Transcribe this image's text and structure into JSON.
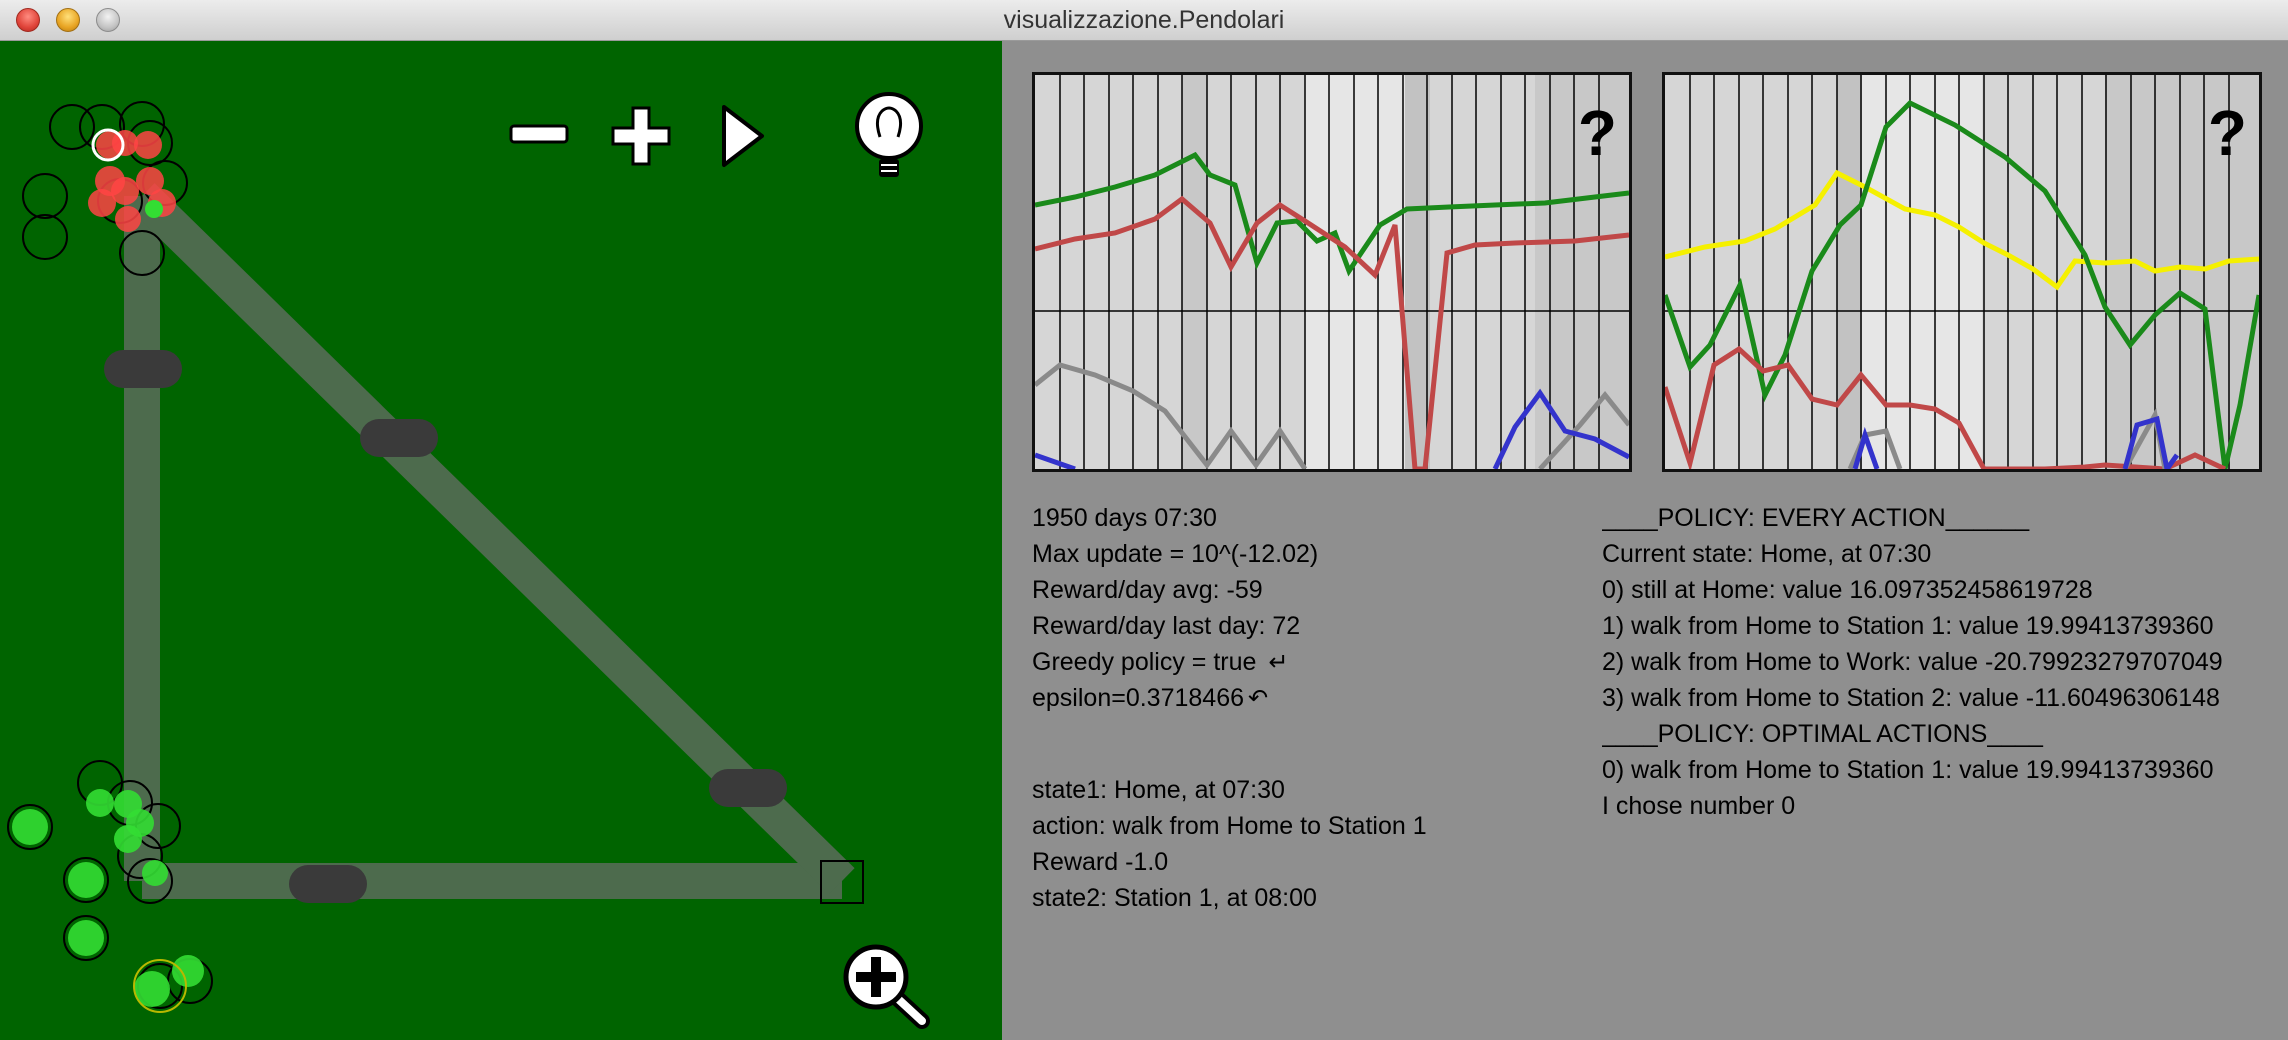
{
  "window": {
    "title": "visualizzazione.Pendolari"
  },
  "controls": {
    "zoom_out": "minus-icon",
    "zoom_in": "plus-icon",
    "play": "play-icon",
    "hint": "lightbulb-icon",
    "magnify": "magnifier-zoom-icon"
  },
  "colors": {
    "sim_background": "#006400",
    "road": "#4a6b4a",
    "station": "#3a3a3a",
    "commuter_red": "#ff4040",
    "commuter_green": "#33dd33",
    "series_green": "#1a8a1a",
    "series_red": "#c04848",
    "series_gray": "#8a8a8a",
    "series_blue": "#3333cc",
    "series_yellow": "#f5f000"
  },
  "stats": {
    "days": "1950 days 07:30",
    "max_update": "Max update = 10^(-12.02)",
    "reward_avg": "Reward/day avg: -59",
    "reward_last": "Reward/day last day: 72",
    "greedy": "Greedy policy = true",
    "greedy_icon": "return-arrow-icon",
    "epsilon": "epsilon=0.3718466",
    "epsilon_icon": "undo-arrow-icon"
  },
  "transition": {
    "state1": "state1: Home, at 07:30",
    "action": "action: walk from Home to Station 1",
    "reward": "Reward -1.0",
    "state2": "state2: Station 1, at 08:00"
  },
  "policy": {
    "header_every": "____POLICY: EVERY ACTION______",
    "current": "Current state: Home, at 07:30",
    "actions": [
      "0) still at Home: value 16.097352458619728",
      "1) walk from Home to Station 1: value 19.99413739360",
      "2) walk from Home to Work: value -20.79923279707049",
      "3) walk from Home to Station 2: value -11.60496306148"
    ],
    "header_optimal": "____POLICY: OPTIMAL ACTIONS____",
    "optimal": [
      "0) walk from Home to Station 1: value 19.99413739360"
    ],
    "chose": "I chose number 0"
  },
  "charts": {
    "left_help": "?",
    "right_help": "?"
  }
}
